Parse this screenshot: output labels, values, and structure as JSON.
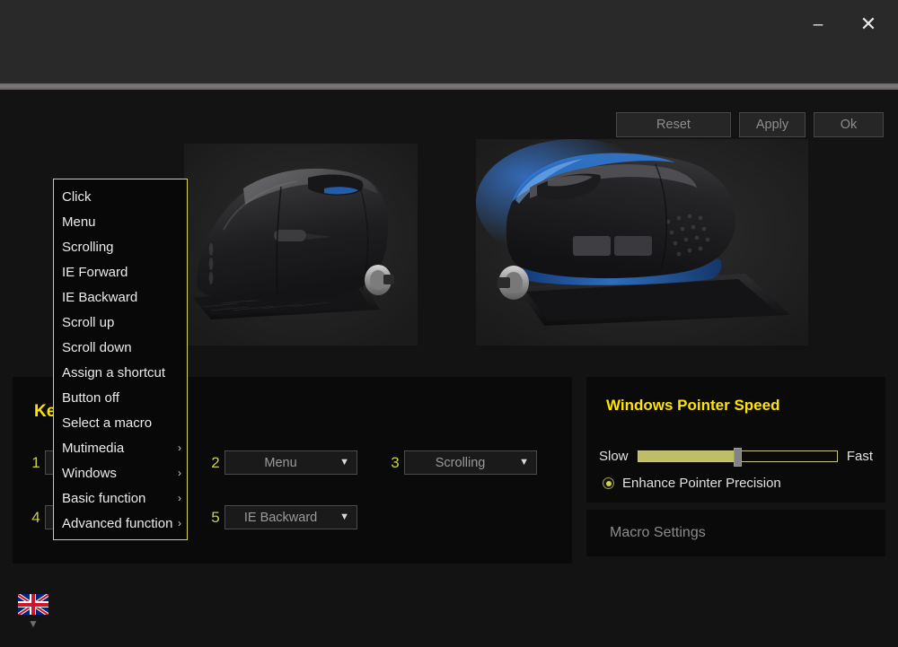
{
  "window": {
    "minimize_label": "–",
    "close_label": "✕"
  },
  "toolbar": {
    "reset_label": "Reset",
    "apply_label": "Apply",
    "ok_label": "Ok"
  },
  "key_settings": {
    "title": "Key Settings",
    "buttons": [
      {
        "number": "1",
        "value": "",
        "arrow": "▼"
      },
      {
        "number": "2",
        "value": "Menu",
        "arrow": "▼"
      },
      {
        "number": "3",
        "value": "Scrolling",
        "arrow": "▼"
      },
      {
        "number": "4",
        "value": "",
        "arrow": "▼"
      },
      {
        "number": "5",
        "value": "IE Backward",
        "arrow": "▼"
      }
    ]
  },
  "pointer_speed": {
    "title": "Windows Pointer Speed",
    "slow_label": "Slow",
    "fast_label": "Fast",
    "slider_percent": 50,
    "enhance_precision_label": "Enhance Pointer Precision",
    "enhance_precision_checked": true
  },
  "macro": {
    "label": "Macro Settings"
  },
  "context_menu": {
    "items": [
      {
        "label": "Click",
        "has_submenu": false,
        "arrow": ""
      },
      {
        "label": "Menu",
        "has_submenu": false,
        "arrow": ""
      },
      {
        "label": "Scrolling",
        "has_submenu": false,
        "arrow": ""
      },
      {
        "label": "IE Forward",
        "has_submenu": false,
        "arrow": ""
      },
      {
        "label": "IE Backward",
        "has_submenu": false,
        "arrow": ""
      },
      {
        "label": "Scroll up",
        "has_submenu": false,
        "arrow": ""
      },
      {
        "label": "Scroll down",
        "has_submenu": false,
        "arrow": ""
      },
      {
        "label": "Assign a shortcut",
        "has_submenu": false,
        "arrow": ""
      },
      {
        "label": "Button off",
        "has_submenu": false,
        "arrow": ""
      },
      {
        "label": "Select a macro",
        "has_submenu": false,
        "arrow": ""
      },
      {
        "label": "Mutimedia",
        "has_submenu": true,
        "arrow": "›"
      },
      {
        "label": "Windows",
        "has_submenu": true,
        "arrow": "›"
      },
      {
        "label": "Basic function",
        "has_submenu": true,
        "arrow": "›"
      },
      {
        "label": "Advanced function",
        "has_submenu": true,
        "arrow": "›"
      }
    ]
  },
  "language": {
    "selected": "English (United Kingdom)",
    "arrow": "▼"
  },
  "colors": {
    "accent_yellow": "#ffe400",
    "menu_border": "#d8d857",
    "slider_fill": "#bcbf63",
    "key_number": "#c9cf4a",
    "panel_bg": "#0a0a0a",
    "window_bg": "#131313",
    "titlebar_bg": "#292929"
  }
}
